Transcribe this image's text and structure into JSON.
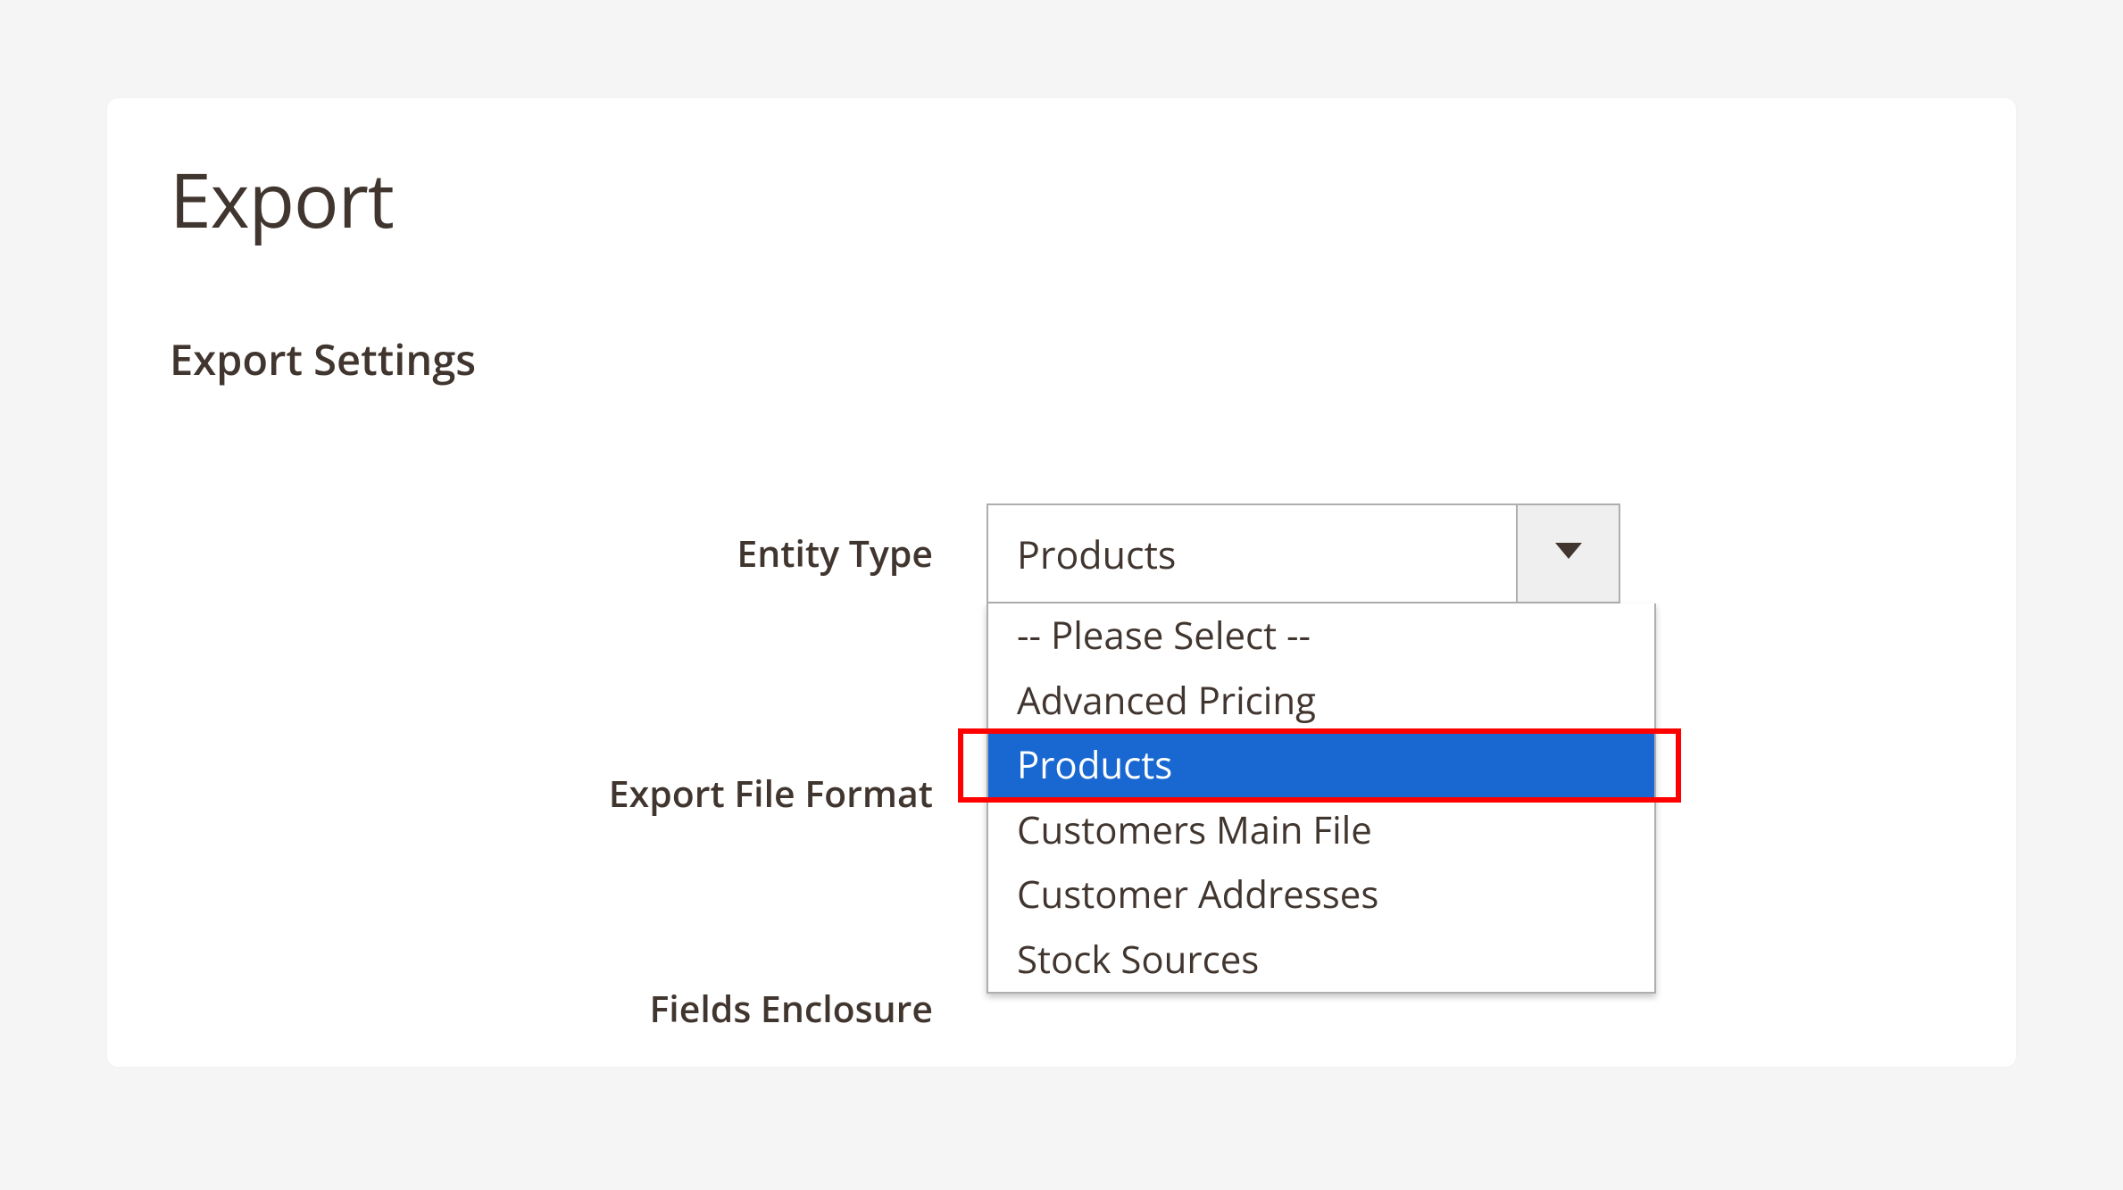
{
  "page": {
    "title": "Export",
    "sectionTitle": "Export Settings"
  },
  "form": {
    "entityType": {
      "label": "Entity Type",
      "selected": "Products",
      "options": [
        {
          "label": "-- Please Select --",
          "selected": false
        },
        {
          "label": "Advanced Pricing",
          "selected": false
        },
        {
          "label": "Products",
          "selected": true
        },
        {
          "label": "Customers Main File",
          "selected": false
        },
        {
          "label": "Customer Addresses",
          "selected": false
        },
        {
          "label": "Stock Sources",
          "selected": false
        }
      ]
    },
    "exportFileFormat": {
      "label": "Export File Format"
    },
    "fieldsEnclosure": {
      "label": "Fields Enclosure"
    }
  }
}
